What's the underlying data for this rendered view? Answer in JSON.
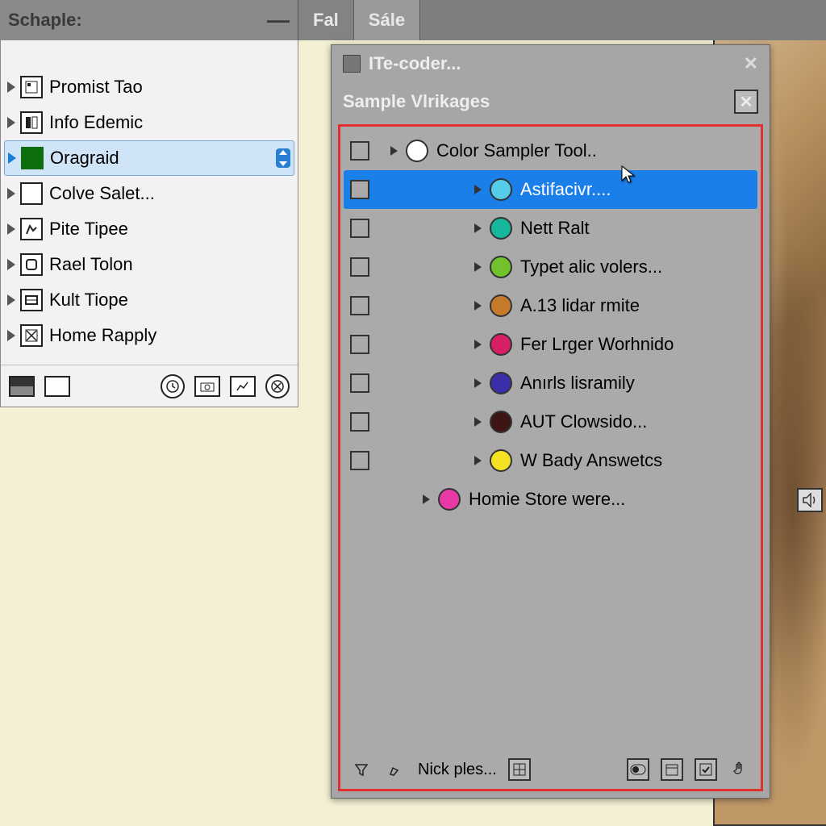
{
  "tabs": {
    "panel_label": "Schaple:",
    "items": [
      "Fal",
      "Sále"
    ]
  },
  "sidebar": {
    "items": [
      {
        "label": "Promist Tao",
        "selected": false
      },
      {
        "label": "Info Edemic",
        "selected": false
      },
      {
        "label": "Oragraid",
        "selected": true
      },
      {
        "label": "Colve Salet...",
        "selected": false
      },
      {
        "label": "Pite Tipee",
        "selected": false
      },
      {
        "label": "Rael Tolon",
        "selected": false
      },
      {
        "label": "Kult Tiope",
        "selected": false
      },
      {
        "label": "Home Rapply",
        "selected": false
      }
    ]
  },
  "popup": {
    "title": "ITe-coder...",
    "subtitle": "Sample Vlrikages",
    "footer_label": "Nick ples...",
    "swatches": [
      {
        "label": "Color Sampler Tool..",
        "color": "#ffffff",
        "indent": 0,
        "checkbox": true,
        "highlight": false
      },
      {
        "label": "Astifacivr....",
        "color": "#55cde8",
        "indent": 1,
        "checkbox": true,
        "highlight": true
      },
      {
        "label": "Nett Ralt",
        "color": "#16b79b",
        "indent": 1,
        "checkbox": true,
        "highlight": false
      },
      {
        "label": "Typet alic volers...",
        "color": "#72c22e",
        "indent": 1,
        "checkbox": true,
        "highlight": false
      },
      {
        "label": "A.13 lidar rmite",
        "color": "#c47a2a",
        "indent": 1,
        "checkbox": true,
        "highlight": false
      },
      {
        "label": "Fer Lrger Worhnido",
        "color": "#d81e64",
        "indent": 1,
        "checkbox": true,
        "highlight": false
      },
      {
        "label": "Anırls lisramily",
        "color": "#3a2fa8",
        "indent": 1,
        "checkbox": true,
        "highlight": false
      },
      {
        "label": "AUT Clowsido...",
        "color": "#3d1613",
        "indent": 1,
        "checkbox": true,
        "highlight": false
      },
      {
        "label": "W Bady Answetcs",
        "color": "#f4e223",
        "indent": 1,
        "checkbox": true,
        "highlight": false
      },
      {
        "label": "Homie Store were...",
        "color": "#e83aa6",
        "indent": 0,
        "checkbox": false,
        "highlight": false
      }
    ]
  }
}
